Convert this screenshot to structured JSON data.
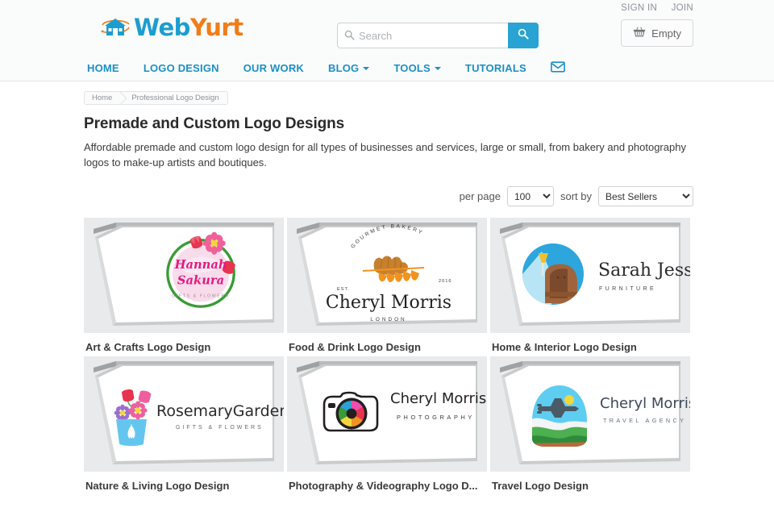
{
  "header": {
    "logo": {
      "icon": "yurt-house-icon",
      "text_primary": "Web",
      "text_secondary": "Yurt",
      "color_primary": "#1b9dd0",
      "color_secondary": "#f07d1a"
    },
    "search": {
      "placeholder": "Search",
      "value": "",
      "icon": "search-icon",
      "button_icon": "search-icon",
      "button_color": "#29a3d4"
    },
    "account": {
      "sign_in": "SIGN IN",
      "join": "JOIN"
    },
    "cart": {
      "icon": "basket-icon",
      "label": "Empty"
    }
  },
  "nav": {
    "items": [
      {
        "label": "HOME",
        "has_dropdown": false,
        "icon": null
      },
      {
        "label": "LOGO DESIGN",
        "has_dropdown": false,
        "icon": null
      },
      {
        "label": "OUR WORK",
        "has_dropdown": false,
        "icon": null
      },
      {
        "label": "BLOG",
        "has_dropdown": true,
        "icon": null
      },
      {
        "label": "TOOLS",
        "has_dropdown": true,
        "icon": null
      },
      {
        "label": "TUTORIALS",
        "has_dropdown": false,
        "icon": null
      },
      {
        "label": "",
        "has_dropdown": false,
        "icon": "envelope-icon"
      }
    ],
    "link_color": "#1b8fc4"
  },
  "breadcrumb": {
    "items": [
      {
        "label": "Home"
      },
      {
        "label": "Professional Logo Design"
      }
    ]
  },
  "main": {
    "title": "Premade and Custom Logo Designs",
    "description": "Affordable premade and custom logo design for all types of businesses and services, large or small, from bakery and photography logos to make-up artists and boutiques.",
    "toolbar": {
      "per_page_label": "per page",
      "per_page_value": "100",
      "per_page_options": [
        "100"
      ],
      "sort_by_label": "sort by",
      "sort_by_value": "Best Sellers",
      "sort_by_options": [
        "Best Sellers"
      ]
    },
    "tiles": [
      {
        "label": "Art & Crafts Logo Design",
        "logo": {
          "kind": "hannah-sakura",
          "name_line1": "Hannah",
          "name_line2": "Sakura",
          "tagline": "GIFTS & FLOWERS",
          "colors": {
            "ring": "#3a9b35",
            "disc": "#f7d6e8",
            "script": "#e4197f",
            "flower": "#f0609a",
            "tulip": "#e8344e",
            "center": "#f2d73c"
          }
        }
      },
      {
        "label": "Food & Drink Logo Design",
        "logo": {
          "kind": "gourmet-bakery",
          "top_text": "GOURMET BAKERY",
          "est_text": "EST.",
          "year_text": "2016",
          "name": "Cheryl Morris",
          "city": "LONDON",
          "colors": {
            "bread": "#c8802e",
            "wheat": "#f0941f",
            "text": "#231f20"
          }
        }
      },
      {
        "label": "Home & Interior Logo Design",
        "logo": {
          "kind": "sarah-jessica-furniture",
          "name": "Sarah Jessica",
          "tagline": "FURNITURE",
          "colors": {
            "sky": "#2da6dd",
            "lightblue": "#b8e5f5",
            "chair": "#a0643c",
            "chair_dark": "#7b4a2c",
            "lamp_shade": "#f0c12c",
            "text": "#2b2b2b"
          }
        }
      },
      {
        "label": "Nature & Living Logo Design",
        "logo": {
          "kind": "rosemary-garden",
          "name": "RosemaryGarden",
          "tagline": "GIFTS & FLOWERS",
          "colors": {
            "vase": "#64c6ef",
            "tulip_red": "#e8344e",
            "tulip_pink": "#ef5fa0",
            "flower_purple": "#9b6fd0",
            "flower_pink": "#ef5fa0",
            "stem": "#4caf50",
            "text": "#2b2b2b"
          }
        }
      },
      {
        "label": "Photography & Videography Logo D...",
        "logo": {
          "kind": "cheryl-morris-photography",
          "name": "Cheryl Morris",
          "tagline": "PHOTOGRAPHY",
          "colors": {
            "body": "#ffffff",
            "outline": "#231f20",
            "a1": "#e8344e",
            "a2": "#f0941f",
            "a3": "#f2d73c",
            "a4": "#3a9b35",
            "a5": "#29a3d4",
            "a6": "#ef4db0"
          }
        }
      },
      {
        "label": "Travel Logo Design",
        "logo": {
          "kind": "cheryl-morris-travel",
          "name": "Cheryl Morris",
          "tagline": "TRAVEL AGENCY",
          "colors": {
            "sky": "#5ecdf2",
            "sun": "#f2d73c",
            "plane": "#4a5a66",
            "snow": "#f2f4f5",
            "grass": "#4caf50",
            "grass_dark": "#2f8b3a",
            "earth": "#b96a3c",
            "text": "#3c4a5a"
          }
        }
      }
    ]
  }
}
